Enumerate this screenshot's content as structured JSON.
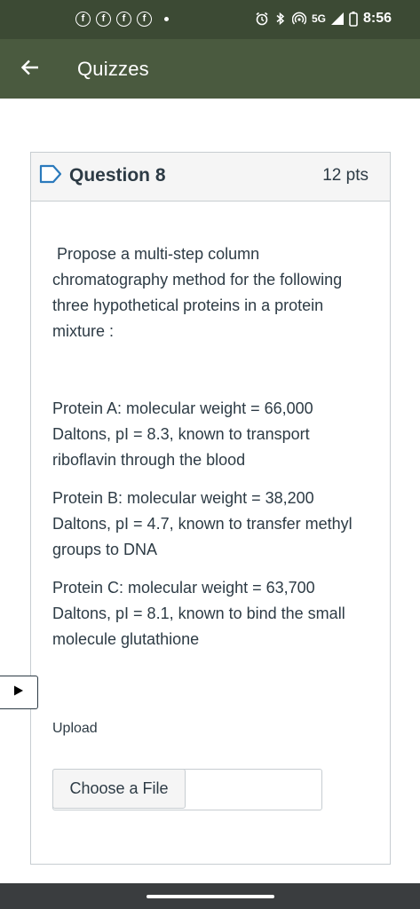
{
  "status_bar": {
    "notification_icons": [
      "facebook-icon",
      "facebook-icon",
      "facebook-icon",
      "facebook-icon"
    ],
    "fb_glyph": "f",
    "network": "5G",
    "time": "8:56"
  },
  "app_bar": {
    "title": "Quizzes",
    "back_icon": "arrow-left-icon"
  },
  "question": {
    "title": "Question 8",
    "points": "12 pts",
    "prompt": "Propose a multi-step column chromatography method for the following three hypothetical proteins in a protein mixture :",
    "proteins": [
      "Protein A: molecular weight = 66,000 Daltons, pI = 8.3, known to transport riboflavin through the blood",
      "Protein B: molecular weight = 38,200 Daltons, pI = 4.7, known to transfer methyl groups to DNA",
      "Protein C: molecular weight = 63,700 Daltons, pI = 8.1, known to bind the small molecule glutathione"
    ],
    "upload_label": "Upload",
    "choose_file_label": "Choose a File"
  },
  "colors": {
    "status_bar": "#3c4a34",
    "app_bar": "#4a5a3f",
    "flag_accent": "#2b7abc",
    "text": "#2d3b45"
  }
}
